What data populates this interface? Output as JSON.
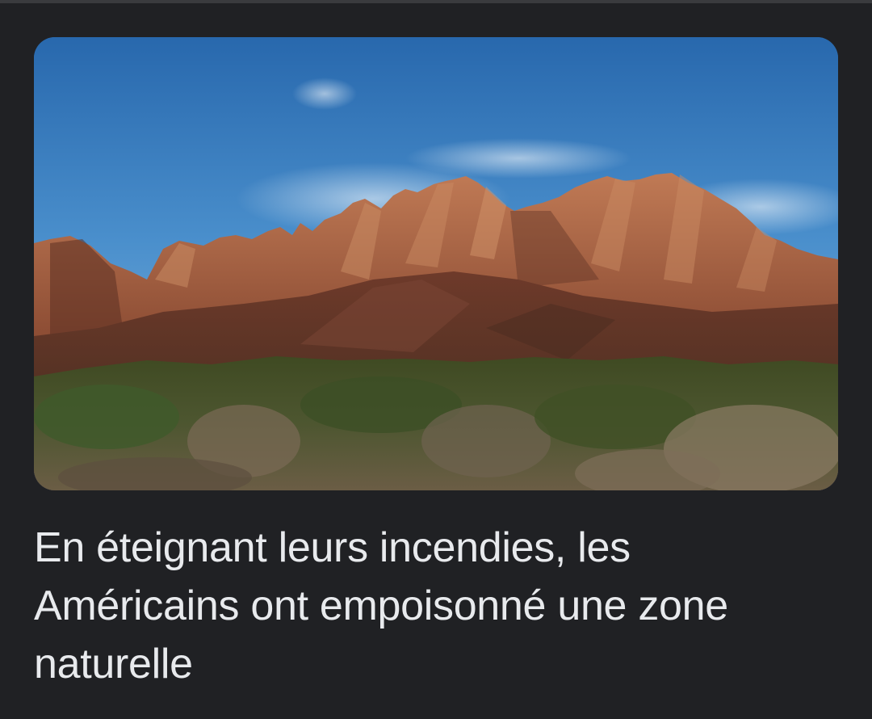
{
  "article": {
    "image_description_icon": "mountain-landscape-image",
    "headline": "En éteignant leurs incendies, les Américains ont empoisonné une zone naturelle"
  },
  "colors": {
    "background": "#202124",
    "headline_text": "#e8eaed",
    "sky_top": "#2a6fb4",
    "sky_bottom": "#7fb2dc",
    "rock": "#a4603f",
    "brush": "#4e5a2c"
  }
}
